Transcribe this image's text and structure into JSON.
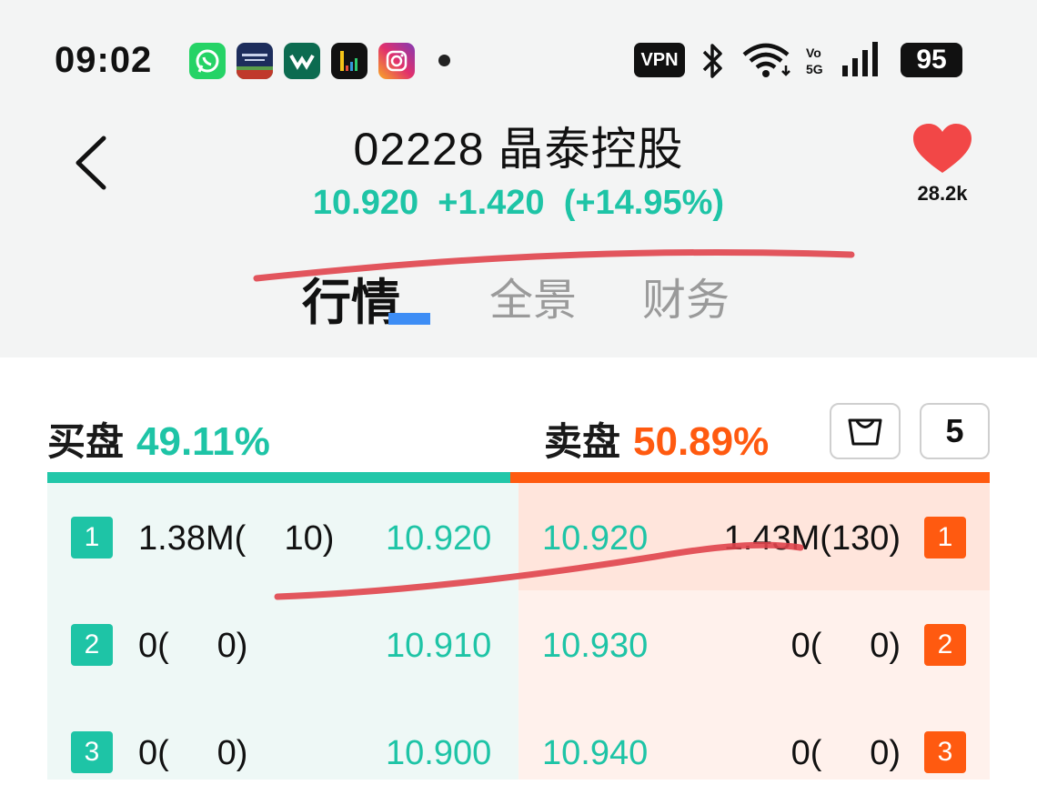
{
  "status_bar": {
    "time": "09:02",
    "notification_icons": [
      "whatsapp-icon",
      "oxford-dictionaries-icon",
      "wechat-work-icon",
      "app-icon",
      "instagram-icon"
    ],
    "vpn_label": "VPN",
    "network": "5G",
    "battery": "95"
  },
  "header": {
    "title": "02228 晶泰控股",
    "price": "10.920",
    "change": "+1.420",
    "change_pct": "(+14.95%)",
    "favorite_count": "28.2k"
  },
  "tabs": [
    {
      "label": "行情",
      "active": true
    },
    {
      "label": "全景",
      "active": false
    },
    {
      "label": "财务",
      "active": false
    }
  ],
  "order_book": {
    "buy_label": "买盘",
    "buy_pct": "49.11%",
    "sell_label": "卖盘",
    "sell_pct": "50.89%",
    "levels_button": "5",
    "buy_ratio": 0.4911,
    "rows": [
      {
        "level": "1",
        "bid_volume": "1.38M(    10)",
        "bid_price": "10.920",
        "ask_price": "10.920",
        "ask_volume": "1.43M(130)"
      },
      {
        "level": "2",
        "bid_volume": "0(     0)",
        "bid_price": "10.910",
        "ask_price": "10.930",
        "ask_volume": "0(     0)"
      },
      {
        "level": "3",
        "bid_volume": "0(     0)",
        "bid_price": "10.900",
        "ask_price": "10.940",
        "ask_volume": "0(     0)"
      }
    ]
  },
  "colors": {
    "up": "#1ec4a6",
    "down": "#ff5a10",
    "annotation_ink": "#e0444c",
    "tab_indicator": "#3d8df5"
  }
}
